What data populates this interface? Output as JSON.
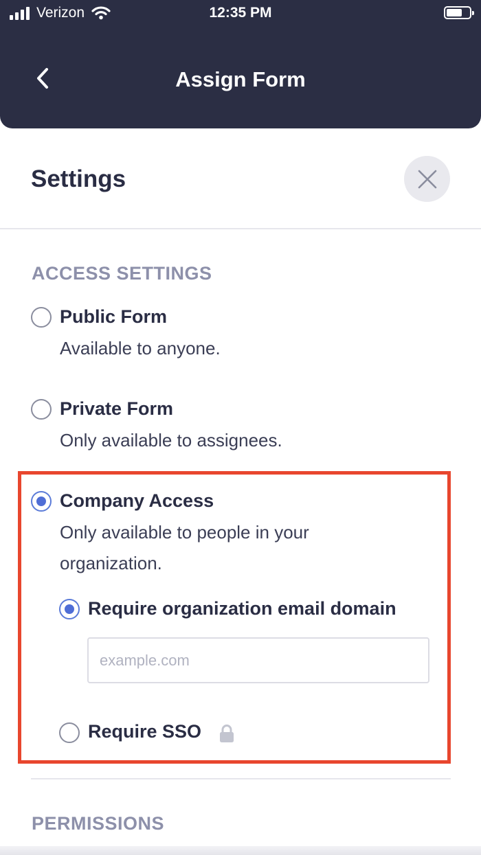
{
  "status_bar": {
    "carrier": "Verizon",
    "time": "12:35 PM"
  },
  "nav": {
    "title": "Assign Form",
    "back_icon": "chevron-left-icon"
  },
  "sheet": {
    "title": "Settings",
    "close_icon": "close-icon"
  },
  "access_settings": {
    "section_title": "ACCESS SETTINGS",
    "options": [
      {
        "label": "Public Form",
        "description": "Available to anyone.",
        "selected": false
      },
      {
        "label": "Private Form",
        "description": "Only available to assignees.",
        "selected": false
      },
      {
        "label": "Company Access",
        "description_line1": "Only available to people in your",
        "description_line2": "organization.",
        "selected": true
      }
    ],
    "company_sub_options": {
      "email_domain": {
        "label": "Require organization email domain",
        "selected": true,
        "placeholder": "example.com",
        "value": ""
      },
      "sso": {
        "label": "Require SSO",
        "selected": false,
        "icon": "lock-icon"
      }
    }
  },
  "permissions": {
    "section_title": "PERMISSIONS"
  },
  "colors": {
    "header_bg": "#2b2e44",
    "accent": "#4f6ed6",
    "highlight": "#e8462e",
    "section_title": "#8d90aa"
  }
}
